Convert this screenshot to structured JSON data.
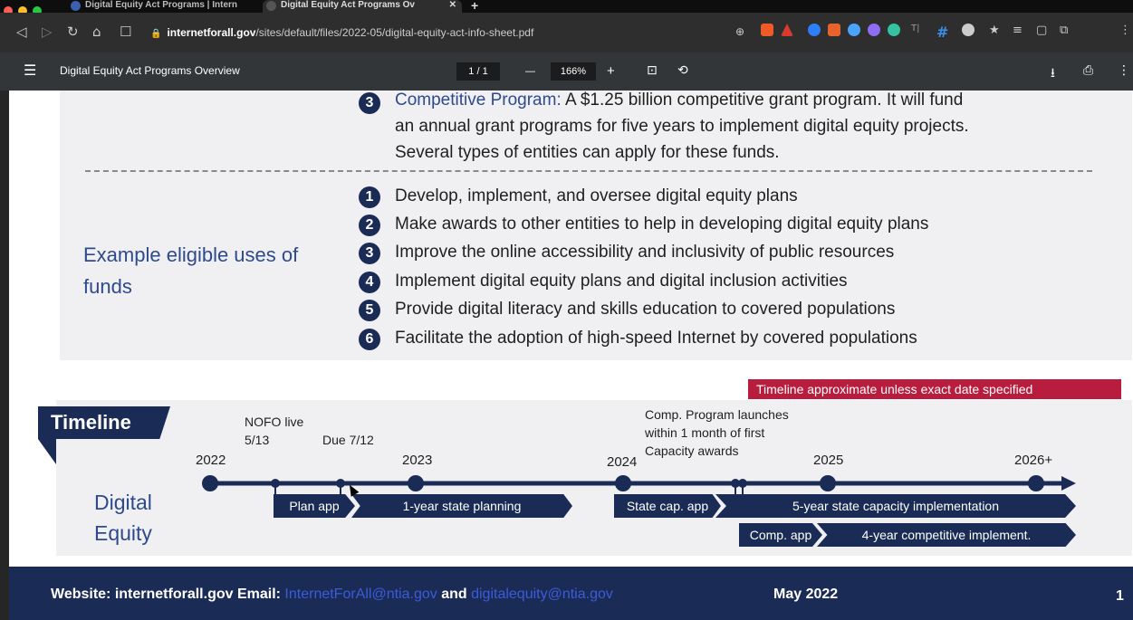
{
  "browser": {
    "tabs": [
      {
        "title": "Digital Equity Act Programs | Intern"
      },
      {
        "title": "Digital Equity Act Programs Ov"
      }
    ],
    "url_host": "internetforall.gov",
    "url_path": "/sites/default/files/2022-05/digital-equity-act-info-sheet.pdf"
  },
  "pdf_toolbar": {
    "title": "Digital Equity Act Programs Overview",
    "page": "1 / 1",
    "zoom": "166%"
  },
  "programs": {
    "competitive_num": "3",
    "competitive_line1_label": "Competitive Program:",
    "competitive_line1_rest": " A $1.25 billion competitive grant program. It will fund",
    "competitive_line2": "an annual grant programs for five years to implement digital equity projects.",
    "competitive_line3": "Several types of entities can apply for these funds."
  },
  "eligible_uses": {
    "label_line1": "Example eligible uses of",
    "label_line2": "funds",
    "items": [
      {
        "num": "1",
        "text": "Develop, implement, and oversee digital equity plans"
      },
      {
        "num": "2",
        "text": "Make awards to other entities to help in developing digital equity plans"
      },
      {
        "num": "3",
        "text": "Improve the online accessibility and inclusivity of public resources"
      },
      {
        "num": "4",
        "text": "Implement digital equity plans and digital inclusion activities"
      },
      {
        "num": "5",
        "text": "Provide digital literacy and skills education to covered populations"
      },
      {
        "num": "6",
        "text": "Facilitate the adoption of high-speed Internet by covered populations"
      }
    ]
  },
  "timeline": {
    "banner": "Timeline approximate unless exact date specified",
    "heading": "Timeline",
    "nofo_line1": "NOFO live",
    "nofo_line2": "5/13",
    "due": "Due 7/12",
    "comp_line1": "Comp. Program launches",
    "comp_line2": "within 1 month of first",
    "comp_line3": "Capacity awards",
    "years": [
      "2022",
      "2023",
      "2024",
      "2025",
      "2026+"
    ],
    "row_label_line1": "Digital",
    "row_label_line2": "Equity",
    "phases": {
      "plan_app": "Plan app",
      "state_planning": "1-year state planning",
      "state_cap_app": "State cap. app",
      "capacity_impl": "5-year state capacity implementation",
      "comp_app": "Comp. app",
      "comp_impl": "4-year competitive implement."
    }
  },
  "footer": {
    "prefix": "Website: internetforall.gov Email: ",
    "email1": "InternetForAll@ntia.gov",
    "and": " and ",
    "email2": "digitalequity@ntia.gov",
    "date": "May 2022",
    "page_number": "1"
  },
  "colors": {
    "navy": "#1a2c55",
    "label_blue": "#2e4a8c",
    "banner_red": "#b91d3e",
    "panel_gray": "#f0f0f3"
  }
}
